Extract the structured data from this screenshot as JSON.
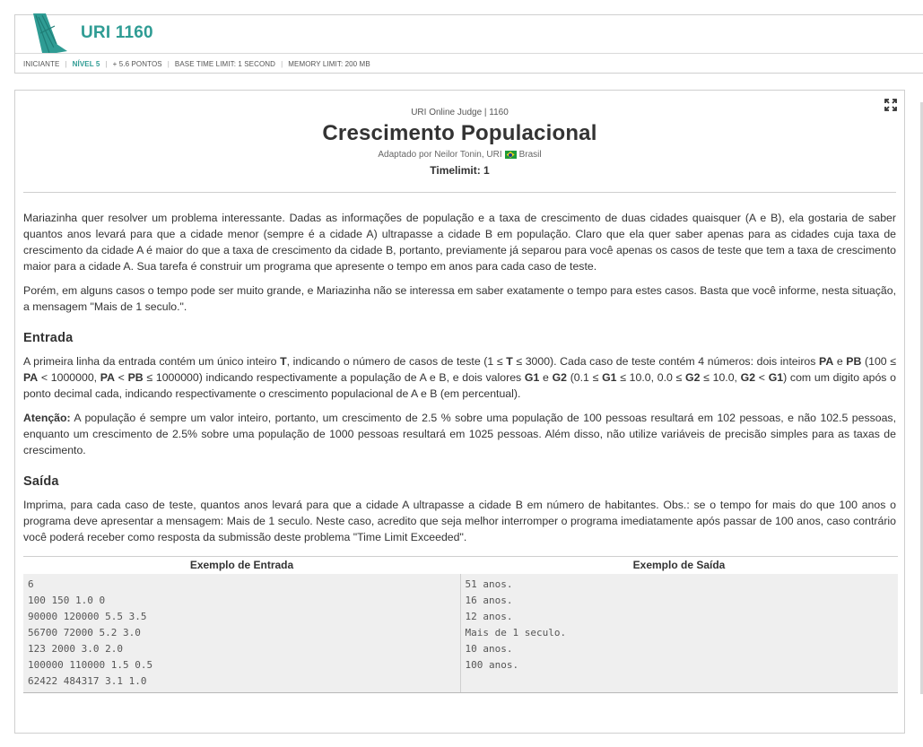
{
  "header": {
    "problem_code": "URI 1160",
    "meta": {
      "category": "INICIANTE",
      "level": "NÍVEL 5",
      "points": "+ 5.6 PONTOS",
      "base_time_limit": "BASE TIME LIMIT: 1 SECOND",
      "memory_limit": "MEMORY LIMIT: 200 MB"
    }
  },
  "problem": {
    "judge_line": "URI Online Judge | 1160",
    "title": "Crescimento Populacional",
    "author_prefix": "Adaptado por Neilor Tonin, URI",
    "author_country": "Brasil",
    "timelimit": "Timelimit: 1",
    "intro": [
      "Mariazinha quer resolver um problema interessante. Dadas as informações de população e a taxa de crescimento de duas cidades quaisquer (A e B), ela gostaria de saber quantos anos levará para que a cidade menor (sempre é a cidade A) ultrapasse a cidade B em população. Claro que ela quer saber apenas para as cidades cuja taxa de crescimento da cidade A é maior do que a taxa de crescimento da cidade B, portanto, previamente já separou para você apenas os casos de teste que tem a taxa de crescimento maior para a cidade A. Sua tarefa é construir um programa que apresente o tempo em anos para cada caso de teste.",
      "Porém, em alguns casos o tempo pode ser muito grande, e Mariazinha não se interessa em saber exatamente o tempo para estes casos. Basta que você informe, nesta situação, a mensagem \"Mais de 1 seculo.\"."
    ],
    "input_heading": "Entrada",
    "input_text": "A primeira linha da entrada contém um único inteiro T, indicando o número de casos de teste (1 ≤ T ≤ 3000). Cada caso de teste contém 4 números: dois inteiros PA e PB (100 ≤ PA < 1000000, PA < PB ≤ 1000000) indicando respectivamente a população de A e B, e dois valores G1 e G2 (0.1 ≤ G1 ≤ 10.0, 0.0 ≤ G2 ≤ 10.0, G2 < G1) com um digito após o ponto decimal cada, indicando respectivamente o crescimento populacional de A e B (em percentual).",
    "attention_label": "Atenção:",
    "attention_text": " A população é sempre um valor inteiro, portanto, um crescimento de 2.5 % sobre uma população de 100 pessoas resultará em 102 pessoas, e não 102.5 pessoas, enquanto um crescimento de 2.5% sobre uma população de 1000 pessoas resultará em 1025 pessoas. Além disso, não utilize variáveis de precisão simples para as taxas de crescimento.",
    "output_heading": "Saída",
    "output_text": "Imprima, para cada caso de teste, quantos anos levará para que a cidade A ultrapasse a cidade B em número de habitantes. Obs.: se o tempo for mais do que 100 anos o programa deve apresentar a mensagem: Mais de 1 seculo. Neste caso, acredito que seja melhor interromper o programa imediatamente após passar de 100 anos, caso contrário você poderá receber como resposta da submissão deste problema \"Time Limit Exceeded\".",
    "sample_input_header": "Exemplo de Entrada",
    "sample_output_header": "Exemplo de Saída",
    "sample_input": [
      "6",
      "100 150 1.0 0",
      "90000 120000 5.5 3.5",
      "56700 72000 5.2 3.0",
      "123 2000 3.0 2.0",
      "100000 110000 1.5 0.5",
      "62422 484317 3.1 1.0"
    ],
    "sample_output": [
      "51 anos.",
      "16 anos.",
      "12 anos.",
      "Mais de 1 seculo.",
      "10 anos.",
      "100 anos."
    ]
  },
  "colors": {
    "brand": "#2f9c94",
    "code_bg": "#efefef"
  },
  "icons": {
    "logo": "uri-logo-icon",
    "expand": "fullscreen-icon",
    "flag": "brazil-flag-icon"
  }
}
